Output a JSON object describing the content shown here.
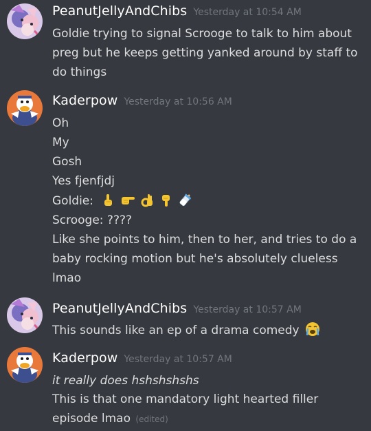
{
  "messages": [
    {
      "author": "PeanutJellyAndChibs",
      "timestamp": "Yesterday at 10:54 AM",
      "lines": [
        "Goldie trying to signal Scrooge to talk to him about",
        "preg but he keeps getting yanked around by staff to",
        "do things"
      ]
    },
    {
      "author": "Kaderpow",
      "timestamp": "Yesterday at 10:56 AM",
      "lines": [
        "Oh",
        "My",
        "Gosh",
        "Yes fjenfjdj",
        "Goldie:",
        "Scrooge: ????",
        "Like she points to him, then to her, and tries to do a",
        "baby rocking motion but he's absolutely clueless",
        "lmao"
      ],
      "emoji_icons": [
        "pointing-up-emoji",
        "pointing-right-emoji",
        "ok-hand-emoji",
        "pointing-down-emoji",
        "baby-bottle-emoji"
      ]
    },
    {
      "author": "PeanutJellyAndChibs",
      "timestamp": "Yesterday at 10:57 AM",
      "lines": [
        "This sounds like an ep of a drama comedy"
      ],
      "emoji_icons": [
        "crying-face-emoji"
      ]
    },
    {
      "author": "Kaderpow",
      "timestamp": "Yesterday at 10:57 AM",
      "lines": [
        "it really does hshshshshs",
        "This is that one mandatory light hearted filler",
        "episode lmao"
      ],
      "edited_label": "(edited)"
    }
  ],
  "colors": {
    "background": "#36393f",
    "username": "#ffffff",
    "timestamp": "#72767d",
    "text": "#dcddde",
    "emoji_yellow": "#f4c431"
  }
}
